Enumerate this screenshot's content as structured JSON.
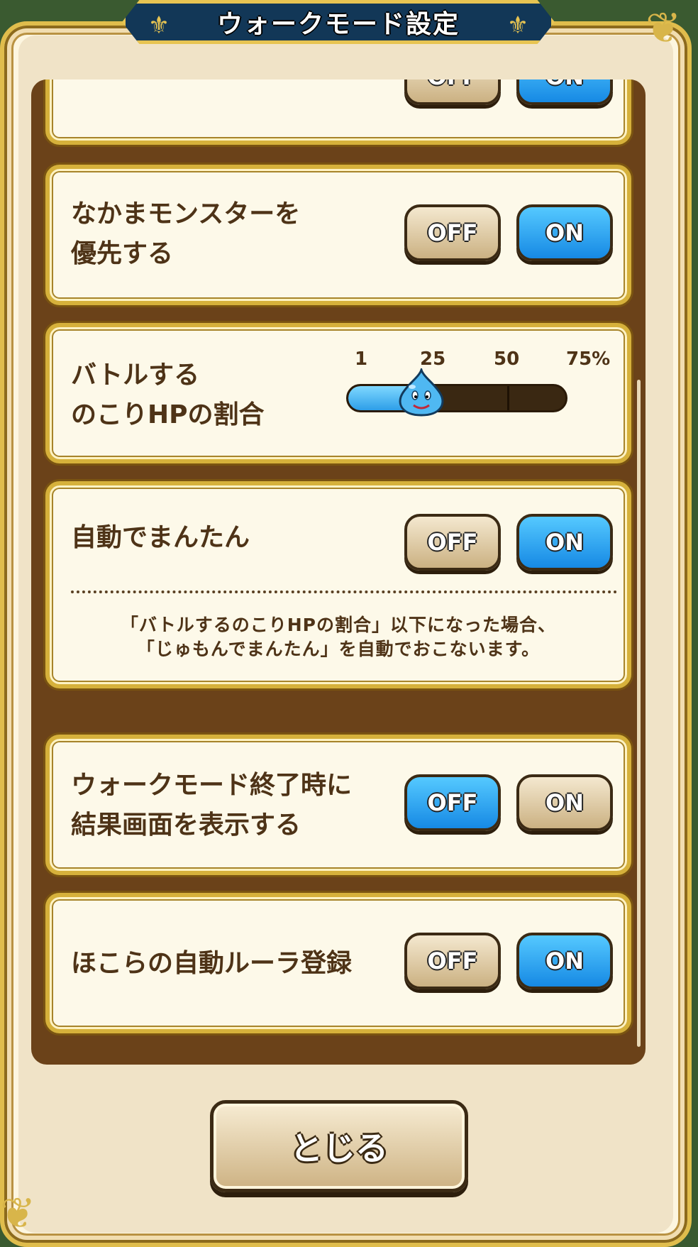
{
  "dialog": {
    "title": "ウォークモード設定",
    "close_label": "とじる"
  },
  "settings": {
    "partial_top": {
      "label": "",
      "off_label": "OFF",
      "on_label": "ON",
      "value": "ON"
    },
    "companion": {
      "label": "なかまモンスターを\n優先する",
      "off_label": "OFF",
      "on_label": "ON",
      "value": "ON"
    },
    "battle_hp": {
      "label": "バトルする\nのこりHPの割合",
      "ticks": [
        "1",
        "25",
        "50",
        "75%"
      ],
      "value": 25
    },
    "auto_heal": {
      "label": "自動でまんたん",
      "off_label": "OFF",
      "on_label": "ON",
      "value": "ON",
      "description": "「バトルするのこりHPの割合」以下になった場合、\n「じゅもんでまんたん」を自動でおこないます。"
    },
    "result_screen": {
      "label": "ウォークモード終了時に\n結果画面を表示する",
      "off_label": "OFF",
      "on_label": "ON",
      "value": "OFF"
    },
    "auto_rula": {
      "label": "ほこらの自動ルーラ登録",
      "off_label": "OFF",
      "on_label": "ON",
      "value": "ON"
    }
  },
  "colors": {
    "on": "#1689e4",
    "off": "#cbb182",
    "text": "#4e3317",
    "frame": "#d6b13b"
  }
}
